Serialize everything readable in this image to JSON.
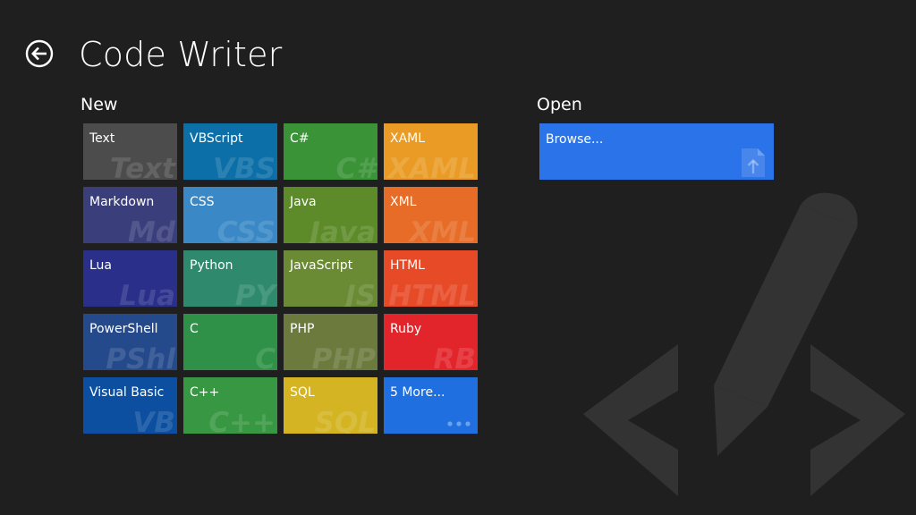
{
  "app": {
    "title": "Code Writer"
  },
  "sections": {
    "new_label": "New",
    "open_label": "Open"
  },
  "tiles": [
    {
      "label": "Text",
      "abbr": "Text",
      "color": "#4c4c4c"
    },
    {
      "label": "VBScript",
      "abbr": "VBS",
      "color": "#0d6fa8"
    },
    {
      "label": "C#",
      "abbr": "C#",
      "color": "#3a9337"
    },
    {
      "label": "XAML",
      "abbr": "XAML",
      "color": "#ea9b25"
    },
    {
      "label": "Markdown",
      "abbr": "Md",
      "color": "#3a3f7c"
    },
    {
      "label": "CSS",
      "abbr": "CSS",
      "color": "#3a89c6"
    },
    {
      "label": "Java",
      "abbr": "Java",
      "color": "#5e8b2a"
    },
    {
      "label": "XML",
      "abbr": "XML",
      "color": "#e66c27"
    },
    {
      "label": "Lua",
      "abbr": "Lua",
      "color": "#2a2f8a"
    },
    {
      "label": "Python",
      "abbr": "PY",
      "color": "#2f8a6d"
    },
    {
      "label": "JavaScript",
      "abbr": "JS",
      "color": "#6a8a34"
    },
    {
      "label": "HTML",
      "abbr": "HTML",
      "color": "#e64a26"
    },
    {
      "label": "PowerShell",
      "abbr": "PShl",
      "color": "#254a8c"
    },
    {
      "label": "C",
      "abbr": "C",
      "color": "#2f9147"
    },
    {
      "label": "PHP",
      "abbr": "PHP",
      "color": "#6d7a3e"
    },
    {
      "label": "Ruby",
      "abbr": "RB",
      "color": "#e2252b"
    },
    {
      "label": "Visual Basic",
      "abbr": "VB",
      "color": "#0c4fa0"
    },
    {
      "label": "C++",
      "abbr": "C++",
      "color": "#389742"
    },
    {
      "label": "SQL",
      "abbr": "SQL",
      "color": "#d4b423"
    },
    {
      "label": "5 More...",
      "abbr": "",
      "color": "#1f6fe0",
      "dots": true
    }
  ],
  "open": {
    "browse_label": "Browse...",
    "color": "#2a73e8"
  },
  "icons": {
    "back": "back-arrow-icon",
    "browse": "file-upload-icon",
    "watermark": "code-pencil-icon",
    "more": "ellipsis-icon"
  }
}
